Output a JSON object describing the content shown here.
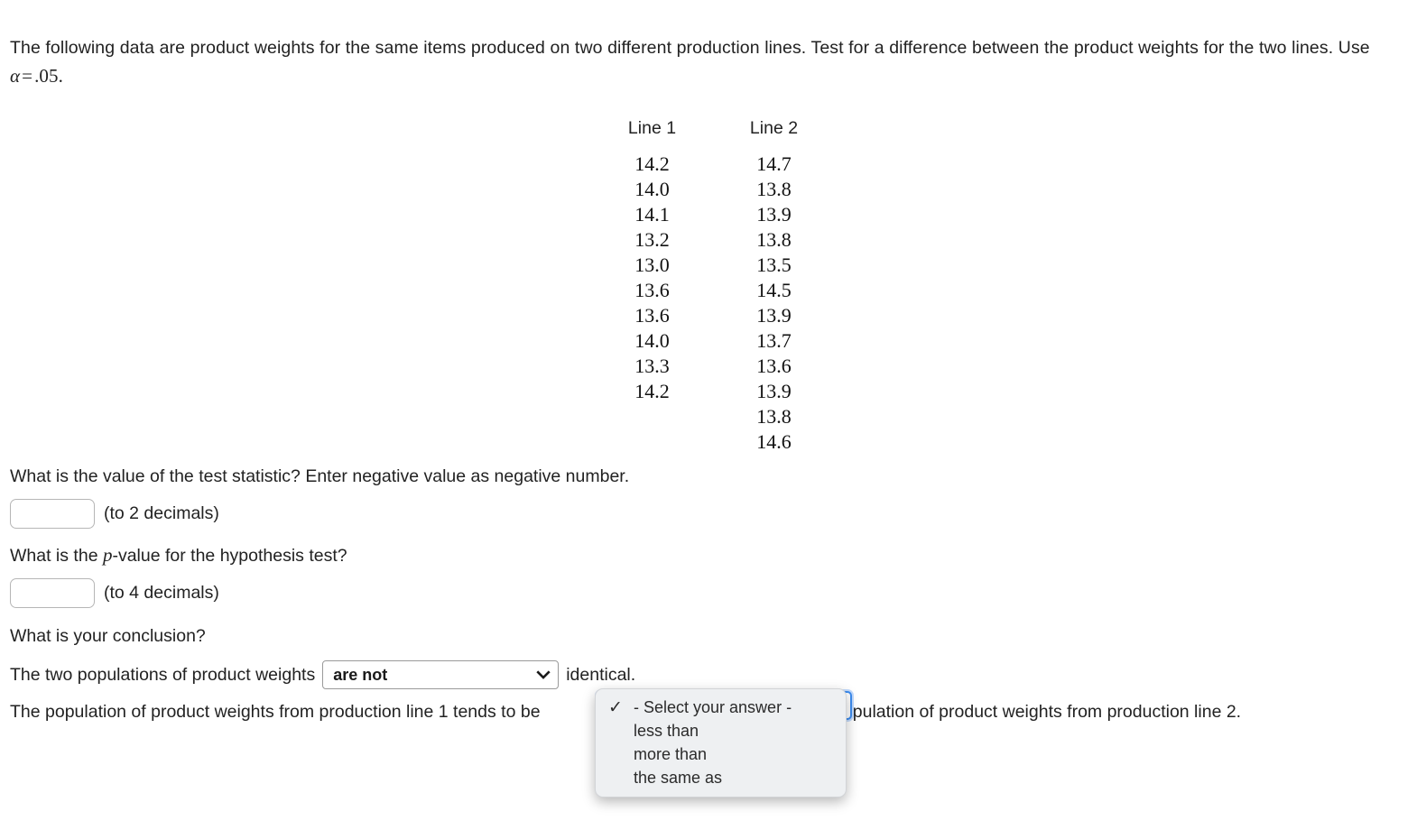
{
  "problem": {
    "intro_part1": "The following data are product weights for the same items produced on two different production lines. Test for a difference between the product weights for the two lines. Use ",
    "intro_alpha": "α",
    "intro_equals": "=",
    "intro_alpha_value": ".05",
    "intro_period": "."
  },
  "chart_data": {
    "type": "table",
    "title": "",
    "columns": [
      "Line 1",
      "Line 2"
    ],
    "series": [
      {
        "name": "Line 1",
        "values": [
          "14.2",
          "14.0",
          "14.1",
          "13.2",
          "13.0",
          "13.6",
          "13.6",
          "14.0",
          "13.3",
          "14.2"
        ]
      },
      {
        "name": "Line 2",
        "values": [
          "14.7",
          "13.8",
          "13.9",
          "13.8",
          "13.5",
          "14.5",
          "13.9",
          "13.7",
          "13.6",
          "13.9",
          "13.8",
          "14.6"
        ]
      }
    ],
    "rows": [
      [
        "14.2",
        "14.7"
      ],
      [
        "14.0",
        "13.8"
      ],
      [
        "14.1",
        "13.9"
      ],
      [
        "13.2",
        "13.8"
      ],
      [
        "13.0",
        "13.5"
      ],
      [
        "13.6",
        "14.5"
      ],
      [
        "13.6",
        "13.9"
      ],
      [
        "14.0",
        "13.7"
      ],
      [
        "13.3",
        "13.6"
      ],
      [
        "14.2",
        "13.9"
      ],
      [
        "",
        "13.8"
      ],
      [
        "",
        "14.6"
      ]
    ]
  },
  "questions": {
    "test_statistic_prompt": "What is the value of the test statistic? Enter negative value as negative number.",
    "test_statistic_value": "",
    "test_statistic_placeholder": "",
    "test_statistic_hint": "(to 2 decimals)",
    "pvalue_prompt_pre": "What is the ",
    "pvalue_prompt_var": "p",
    "pvalue_prompt_post": "-value for the hypothesis test?",
    "pvalue_value": "",
    "pvalue_placeholder": "",
    "pvalue_hint": "(to 4 decimals)",
    "conclusion_prompt": "What is your conclusion?"
  },
  "conclusion": {
    "sentence1_pre": "The two populations of product weights",
    "sentence1_post": "identical.",
    "select1_value": "are not",
    "sentence2_pre": "The population of product weights from production line 1 tends to be",
    "sentence2_post": "the population of product weights from production line 2."
  },
  "dropdown": {
    "open": true,
    "selected_index": 0,
    "check_glyph": "✓",
    "items": [
      "- Select your answer -",
      "less than",
      "more than",
      "the same as"
    ]
  },
  "icons": {
    "chevron_down": "chevron-down-icon"
  },
  "colors": {
    "text": "#222222",
    "focus_ring": "#3c8cf0",
    "popup_bg": "#eef0f2",
    "input_border": "#b6b6b6"
  }
}
